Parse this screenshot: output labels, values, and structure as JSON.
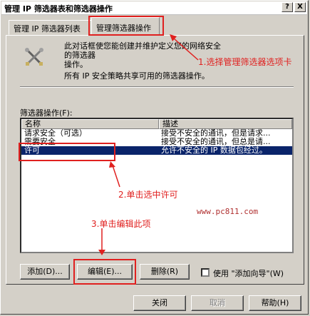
{
  "window": {
    "title": "管理 IP 筛选器表和筛选器操作",
    "help_glyph": "?",
    "close_glyph": "X"
  },
  "tabs": [
    {
      "label": "管理 IP 筛选器列表"
    },
    {
      "label": "管理筛选器操作"
    }
  ],
  "intro": {
    "description": "此对话框使您能创建并维护定义您的网络安全的筛选器操作。",
    "description_line1": "此对话框使您能创建并维护定义您的网络安全的筛选器",
    "description_line2": "操作。",
    "note": "所有 IP 安全策略共享可用的筛选器操作。"
  },
  "list": {
    "label": "筛选器操作(F):",
    "columns": [
      "名称",
      "描述"
    ],
    "rows": [
      {
        "name": "请求安全（可选）",
        "desc": "接受不安全的通讯，但是请求..."
      },
      {
        "name": "需要安全",
        "desc": "接受不安全的通讯，但总是请..."
      },
      {
        "name": "许可",
        "desc": "允许不安全的 IP 数据包经过。"
      }
    ],
    "selected_index": 2
  },
  "buttons": {
    "add": "添加(D)...",
    "edit": "编辑(E)...",
    "remove": "删除(R)",
    "wizard": "使用 \"添加向导\"(W)",
    "close": "关闭",
    "cancel": "取消",
    "help": "帮助(H)"
  },
  "annotations": {
    "step1": "1.选择管理筛选器选项卡",
    "step2": "2.单击选中许可",
    "step3": "3.单击编辑此项",
    "watermark": "www.pc811.com"
  },
  "colors": {
    "annotation_red": "#e0201f",
    "selection": "#0a246a",
    "face": "#d4d0c8"
  }
}
